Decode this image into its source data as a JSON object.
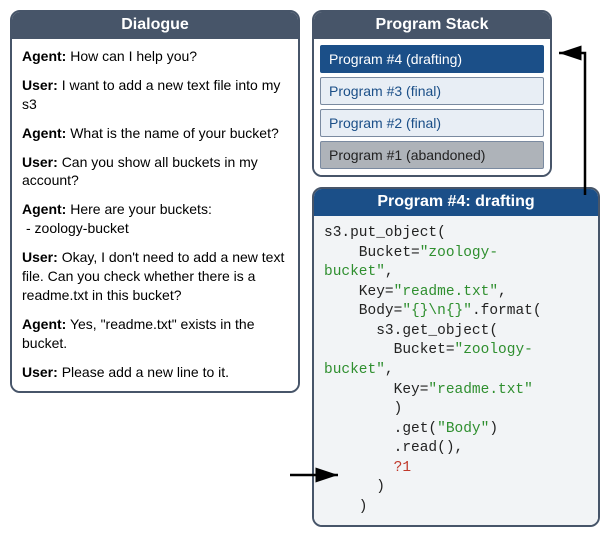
{
  "dialogue": {
    "title": "Dialogue",
    "turns": [
      {
        "speaker": "Agent:",
        "text": "How can I help you?"
      },
      {
        "speaker": "User:",
        "text": "I want to add a new text file into my s3"
      },
      {
        "speaker": "Agent:",
        "text": "What is the name of your bucket?"
      },
      {
        "speaker": "User:",
        "text": "Can you show all buckets in my account?"
      },
      {
        "speaker": "Agent:",
        "text": "Here are your buckets:",
        "bullets": [
          " - zoology-bucket"
        ]
      },
      {
        "speaker": "User:",
        "text": "Okay, I don't need to add a new text file. Can you check whether there is a readme.txt in this bucket?"
      },
      {
        "speaker": "Agent:",
        "text": "Yes, \"readme.txt\" exists in the bucket."
      },
      {
        "speaker": "User:",
        "text": "Please add a new line to it."
      }
    ]
  },
  "stack": {
    "title": "Program Stack",
    "items": [
      {
        "label": "Program #4 (drafting)",
        "state": "active"
      },
      {
        "label": "Program #3 (final)",
        "state": "normal"
      },
      {
        "label": "Program #2 (final)",
        "state": "normal"
      },
      {
        "label": "Program #1 (abandoned)",
        "state": "abandoned"
      }
    ]
  },
  "program": {
    "title": "Program #4: drafting",
    "code": {
      "l1": "s3.put_object(",
      "l2a": "    Bucket=",
      "l2s": "\"zoology-",
      "l3s": "bucket\"",
      "l3b": ",",
      "l4a": "    Key=",
      "l4s": "\"readme.txt\"",
      "l4b": ",",
      "l5a": "    Body=",
      "l5s": "\"{}\\n{}\"",
      "l5b": ".format(",
      "l6": "      s3.get_object(",
      "l7a": "        Bucket=",
      "l7s": "\"zoology-",
      "l8s": "bucket\"",
      "l8b": ",",
      "l9a": "        Key=",
      "l9s": "\"readme.txt\"",
      "l10": "        )",
      "l11a": "        .get(",
      "l11s": "\"Body\"",
      "l11b": ")",
      "l12": "        .read(),",
      "l13a": "        ",
      "l13e": "?1",
      "l14": "      )",
      "l15": "    )"
    }
  }
}
